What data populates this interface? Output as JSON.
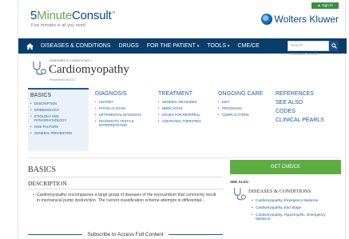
{
  "header": {
    "logo_5": "5",
    "logo_minute": "Minute",
    "logo_consult": "Consult",
    "logo_tm": "™",
    "tagline": "Five minutes is all you need",
    "signin": "▲ Sign In",
    "wk_logo": "Wolters Kluwer"
  },
  "nav": {
    "items": [
      {
        "label": "DISEASES & CONDITIONS",
        "caret": ""
      },
      {
        "label": "DRUGS",
        "caret": ""
      },
      {
        "label": "FOR THE PATIENT",
        "caret": "▾"
      },
      {
        "label": "TOOLS",
        "caret": "▾"
      },
      {
        "label": "CME/CE",
        "caret": ""
      }
    ],
    "search_placeholder": "Search 5MinuteConsult"
  },
  "title_area": {
    "breadcrumb": "DISEASES & CONDITIONS >",
    "title": "Cardiomyopathy",
    "reviewed": "Reviewed 06/2017"
  },
  "menu": {
    "basics": {
      "heading": "BASICS",
      "items": [
        "DESCRIPTION",
        "EPIDEMIOLOGY",
        "ETIOLOGY AND PATHOPHYSIOLOGY",
        "RISK FACTORS",
        "GENERAL PREVENTION"
      ]
    },
    "diagnosis": {
      "heading": "DIAGNOSIS",
      "items": [
        "HISTORY",
        "PHYSICAL EXAM",
        "DIFFERENTIAL DIAGNOSIS",
        "DIAGNOSTIC TESTS & INTERPRETATION"
      ]
    },
    "treatment": {
      "heading": "TREATMENT",
      "items": [
        "GENERAL MEASURES",
        "MEDICATION",
        "ISSUES FOR REFERRAL",
        "ADDITIONAL THERAPIES"
      ]
    },
    "ongoing": {
      "heading": "ONGOING CARE",
      "items": [
        "DIET",
        "PROGNOSIS",
        "COMPLICATIONS"
      ]
    },
    "refs": {
      "links": [
        "REFERENCES",
        "SEE ALSO",
        "CODES",
        "CLINICAL PEARLS"
      ]
    }
  },
  "body": {
    "section_title": "BASICS",
    "desc_heading": "DESCRIPTION",
    "desc_text": "Cardiomyopathy encompasses a large group of diseases of the myocardium that commonly result in mechanical pump dysfunction. The current classification scheme attempts to differentiat...",
    "subscribe": "Subscribe to Access Full Content"
  },
  "sidebar": {
    "cme_button": "GET CME/CE",
    "see_also": "SEE ALSO",
    "ddc_title": "DISEASES & CONDITIONS",
    "items": [
      "Cardiomyopathy, Emergency Medicine",
      "Cardiomyopathy, End Stage",
      "Cardiomyopathy, Hypertrophic, Emergency Medicine"
    ]
  },
  "colors": {
    "nav_bg": "#0b3d6b",
    "link": "#1d5aa0",
    "cme_green": "#5fad41",
    "basics_bg": "#eaf1f8"
  }
}
